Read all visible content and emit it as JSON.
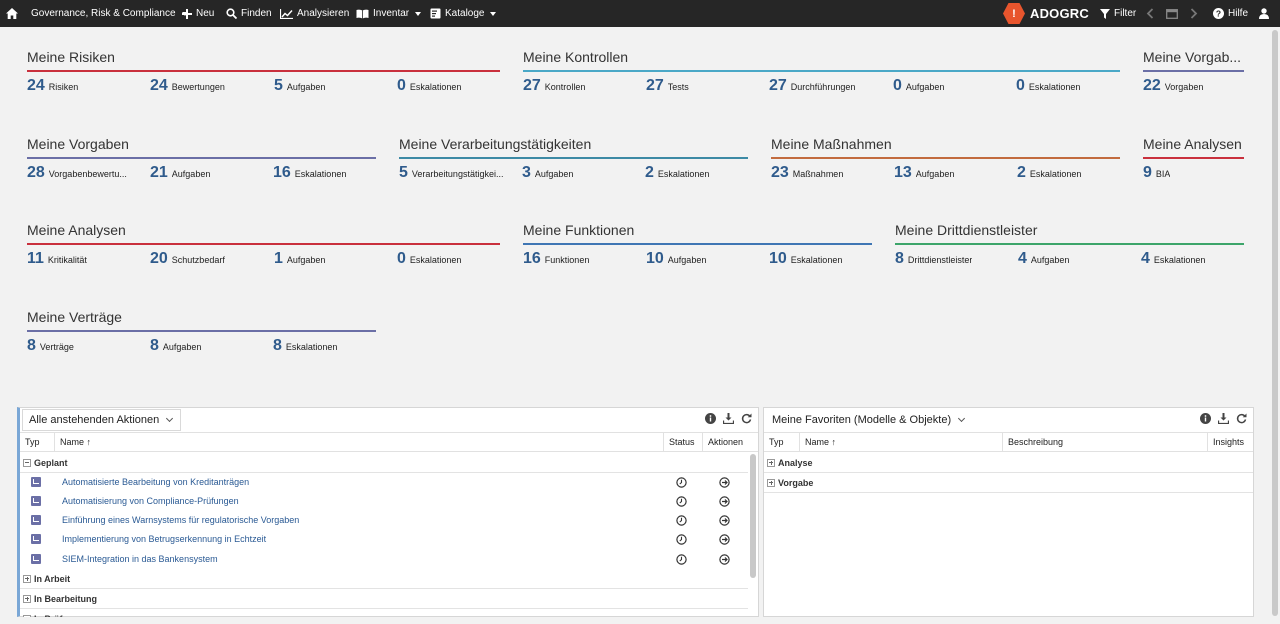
{
  "topbar": {
    "home_icon": "home-icon",
    "workspace": "Governance, Risk & Compliance",
    "new_label": "Neu",
    "find_label": "Finden",
    "analyze_label": "Analysieren",
    "inventory_label": "Inventar",
    "catalogs_label": "Kataloge",
    "logo_mark": "!",
    "logo_text": "ADOGRC",
    "filter_label": "Filter",
    "help_label": "Hilfe"
  },
  "sections": {
    "risks": {
      "title": "Meine Risiken",
      "color": "#c9303d",
      "metrics": [
        {
          "num": "24",
          "label": "Risiken"
        },
        {
          "num": "24",
          "label": "Bewertungen"
        },
        {
          "num": "5",
          "label": "Aufgaben"
        },
        {
          "num": "0",
          "label": "Eskalationen"
        }
      ]
    },
    "controls": {
      "title": "Meine Kontrollen",
      "color": "#4aa8c7",
      "metrics": [
        {
          "num": "27",
          "label": "Kontrollen"
        },
        {
          "num": "27",
          "label": "Tests"
        },
        {
          "num": "27",
          "label": "Durchführungen"
        },
        {
          "num": "0",
          "label": "Aufgaben"
        },
        {
          "num": "0",
          "label": "Eskalationen"
        }
      ]
    },
    "vorgaben_short": {
      "title": "Meine Vorgab...",
      "color": "#6b6fa6",
      "metrics": [
        {
          "num": "22",
          "label": "Vorgaben"
        }
      ]
    },
    "vorgaben": {
      "title": "Meine Vorgaben",
      "color": "#6b6fa6",
      "metrics": [
        {
          "num": "28",
          "label": "Vorgabenbewertu..."
        },
        {
          "num": "21",
          "label": "Aufgaben"
        },
        {
          "num": "16",
          "label": "Eskalationen"
        }
      ]
    },
    "processing": {
      "title": "Meine Verarbeitungstätigkeiten",
      "color": "#3d8aa5",
      "metrics": [
        {
          "num": "5",
          "label": "Verarbeitungstätigkei..."
        },
        {
          "num": "3",
          "label": "Aufgaben"
        },
        {
          "num": "2",
          "label": "Eskalationen"
        }
      ]
    },
    "measures": {
      "title": "Meine Maßnahmen",
      "color": "#c26b3e",
      "metrics": [
        {
          "num": "23",
          "label": "Maßnahmen"
        },
        {
          "num": "13",
          "label": "Aufgaben"
        },
        {
          "num": "2",
          "label": "Eskalationen"
        }
      ]
    },
    "analyses_short": {
      "title": "Meine Analysen",
      "color": "#c9303d",
      "metrics": [
        {
          "num": "9",
          "label": "BIA"
        }
      ]
    },
    "analyses": {
      "title": "Meine Analysen",
      "color": "#c9303d",
      "metrics": [
        {
          "num": "11",
          "label": "Kritikalität"
        },
        {
          "num": "20",
          "label": "Schutzbedarf"
        },
        {
          "num": "1",
          "label": "Aufgaben"
        },
        {
          "num": "0",
          "label": "Eskalationen"
        }
      ]
    },
    "functions": {
      "title": "Meine Funktionen",
      "color": "#3f76b4",
      "metrics": [
        {
          "num": "16",
          "label": "Funktionen"
        },
        {
          "num": "10",
          "label": "Aufgaben"
        },
        {
          "num": "10",
          "label": "Eskalationen"
        }
      ]
    },
    "third_party": {
      "title": "Meine Drittdienstleister",
      "color": "#3da56a",
      "metrics": [
        {
          "num": "8",
          "label": "Drittdienstleister"
        },
        {
          "num": "4",
          "label": "Aufgaben"
        },
        {
          "num": "4",
          "label": "Eskalationen"
        }
      ]
    },
    "contracts": {
      "title": "Meine Verträge",
      "color": "#6b6fa6",
      "metrics": [
        {
          "num": "8",
          "label": "Verträge"
        },
        {
          "num": "8",
          "label": "Aufgaben"
        },
        {
          "num": "8",
          "label": "Eskalationen"
        }
      ]
    }
  },
  "actions_panel": {
    "dropdown": "Alle anstehenden Aktionen",
    "columns": {
      "type": "Typ",
      "name": "Name ↑",
      "status": "Status",
      "actions": "Aktionen"
    },
    "groups": [
      "Geplant",
      "In Arbeit",
      "In Bearbeitung",
      "In Prüfung"
    ],
    "items": [
      "Automatisierte Bearbeitung von Kreditanträgen",
      "Automatisierung von Compliance-Prüfungen",
      "Einführung eines Warnsystems für regulatorische Vorgaben",
      "Implementierung von Betrugserkennung in Echtzeit",
      "SIEM-Integration in das Bankensystem"
    ]
  },
  "favorites_panel": {
    "dropdown": "Meine Favoriten (Modelle & Objekte)",
    "columns": {
      "type": "Typ",
      "name": "Name ↑",
      "description": "Beschreibung",
      "insights": "Insights"
    },
    "groups": [
      "Analyse",
      "Vorgabe"
    ]
  }
}
